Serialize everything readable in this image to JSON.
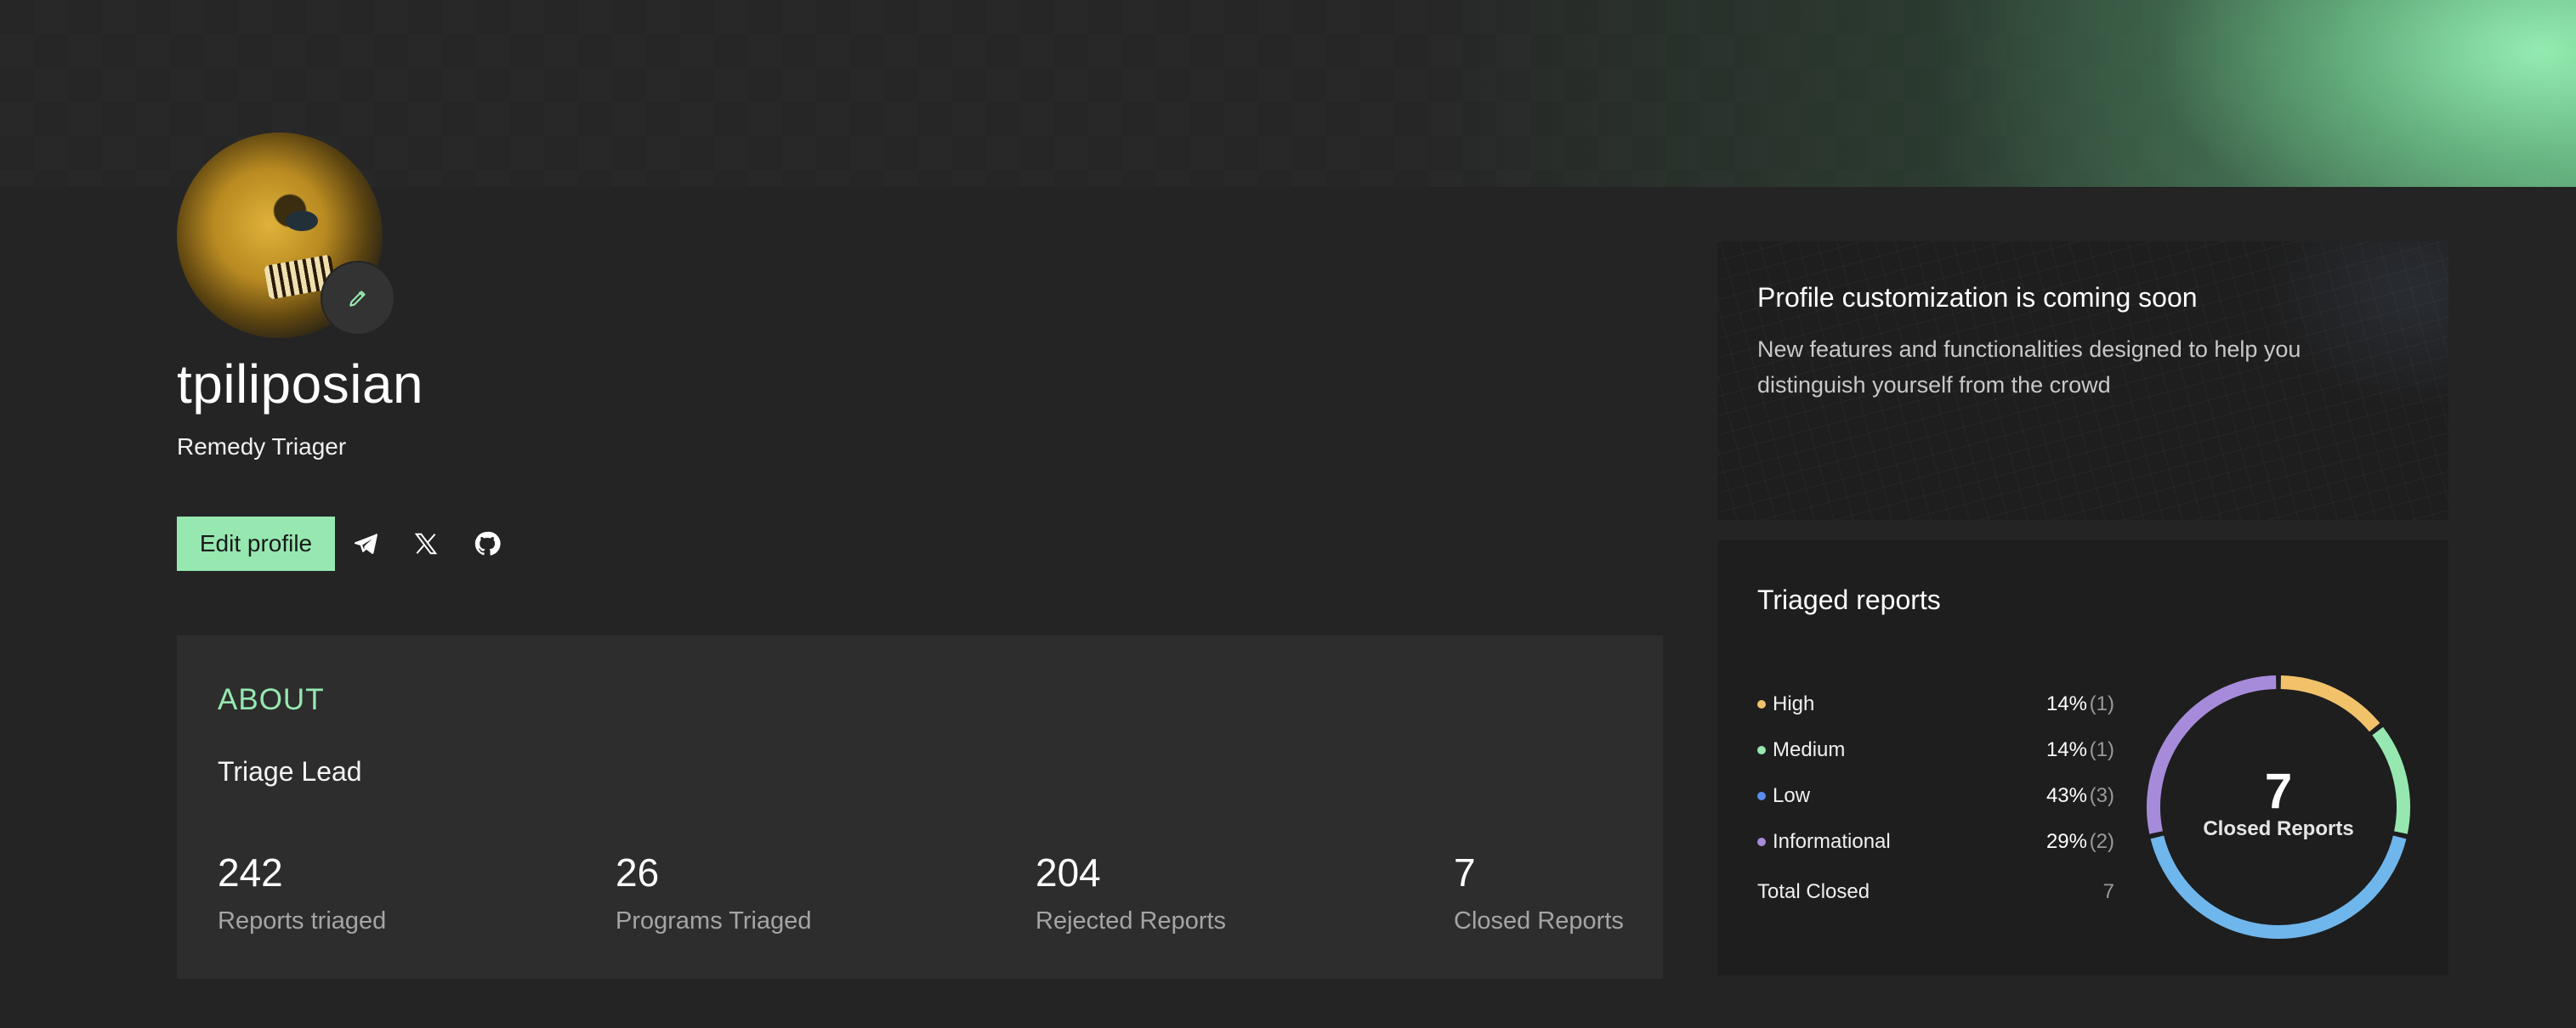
{
  "profile": {
    "username": "tpiliposian",
    "role": "Remedy Triager",
    "edit_label": "Edit profile"
  },
  "social": [
    "telegram-icon",
    "x-icon",
    "github-icon"
  ],
  "about": {
    "title": "ABOUT",
    "text": "Triage Lead",
    "stats": [
      {
        "value": "242",
        "label": "Reports triaged"
      },
      {
        "value": "26",
        "label": "Programs Triaged"
      },
      {
        "value": "204",
        "label": "Rejected Reports"
      },
      {
        "value": "7",
        "label": "Closed Reports"
      }
    ]
  },
  "promo": {
    "title": "Profile customization is coming soon",
    "desc": "New features and functionalities designed to help you distinguish yourself from the crowd"
  },
  "triaged": {
    "title": "Triaged reports",
    "items": [
      {
        "name": "High",
        "pct": "14%",
        "count": "(1)",
        "color": "#f2c26b"
      },
      {
        "name": "Medium",
        "pct": "14%",
        "count": "(1)",
        "color": "#96e8b0"
      },
      {
        "name": "Low",
        "pct": "43%",
        "count": "(3)",
        "color": "#5b8def"
      },
      {
        "name": "Informational",
        "pct": "29%",
        "count": "(2)",
        "color": "#a78bdb"
      }
    ],
    "total_label": "Total Closed",
    "total_value": "7",
    "center_value": "7",
    "center_label": "Closed Reports"
  },
  "colors": {
    "accent": "#96e8b0",
    "donut_high": "#f2c26b",
    "donut_medium": "#96e8b0",
    "donut_low": "#6fb6ec",
    "donut_info": "#a78bdb"
  }
}
